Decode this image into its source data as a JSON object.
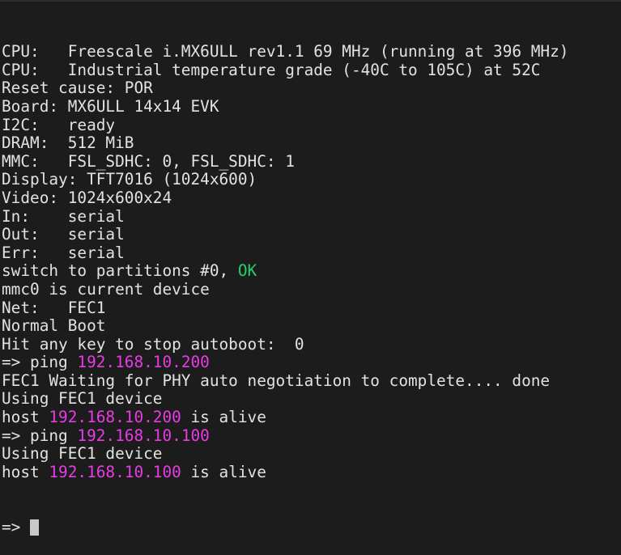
{
  "colors": {
    "background": "#1c1c1c",
    "text": "#e2e2e2",
    "ip": "#e83be6",
    "ok": "#23d16b"
  },
  "lines": [
    [
      {
        "t": "CPU:   Freescale i.MX6ULL rev1.1 69 MHz (running at 396 MHz)"
      }
    ],
    [
      {
        "t": "CPU:   Industrial temperature grade (-40C to 105C) at 52C"
      }
    ],
    [
      {
        "t": "Reset cause: POR"
      }
    ],
    [
      {
        "t": "Board: MX6ULL 14x14 EVK"
      }
    ],
    [
      {
        "t": "I2C:   ready"
      }
    ],
    [
      {
        "t": "DRAM:  512 MiB"
      }
    ],
    [
      {
        "t": "MMC:   FSL_SDHC: 0, FSL_SDHC: 1"
      }
    ],
    [
      {
        "t": "Display: TFT7016 (1024x600)"
      }
    ],
    [
      {
        "t": "Video: 1024x600x24"
      }
    ],
    [
      {
        "t": "In:    serial"
      }
    ],
    [
      {
        "t": "Out:   serial"
      }
    ],
    [
      {
        "t": "Err:   serial"
      }
    ],
    [
      {
        "t": "switch to partitions #0, "
      },
      {
        "t": "OK",
        "c": "ok"
      }
    ],
    [
      {
        "t": "mmc0 is current device"
      }
    ],
    [
      {
        "t": "Net:   FEC1"
      }
    ],
    [
      {
        "t": "Normal Boot"
      }
    ],
    [
      {
        "t": "Hit any key to stop autoboot:  0"
      }
    ],
    [
      {
        "t": "=> ping "
      },
      {
        "t": "192.168.10.200",
        "c": "ip"
      }
    ],
    [
      {
        "t": "FEC1 Waiting for PHY auto negotiation to complete.... done"
      }
    ],
    [
      {
        "t": "Using FEC1 device"
      }
    ],
    [
      {
        "t": "host "
      },
      {
        "t": "192.168.10.200",
        "c": "ip"
      },
      {
        "t": " is alive"
      }
    ],
    [
      {
        "t": "=> ping "
      },
      {
        "t": "192.168.10.100",
        "c": "ip"
      }
    ],
    [
      {
        "t": "Using FEC1 device"
      }
    ],
    [
      {
        "t": "host "
      },
      {
        "t": "192.168.10.100",
        "c": "ip"
      },
      {
        "t": " is alive"
      }
    ]
  ],
  "prompt": "=> "
}
